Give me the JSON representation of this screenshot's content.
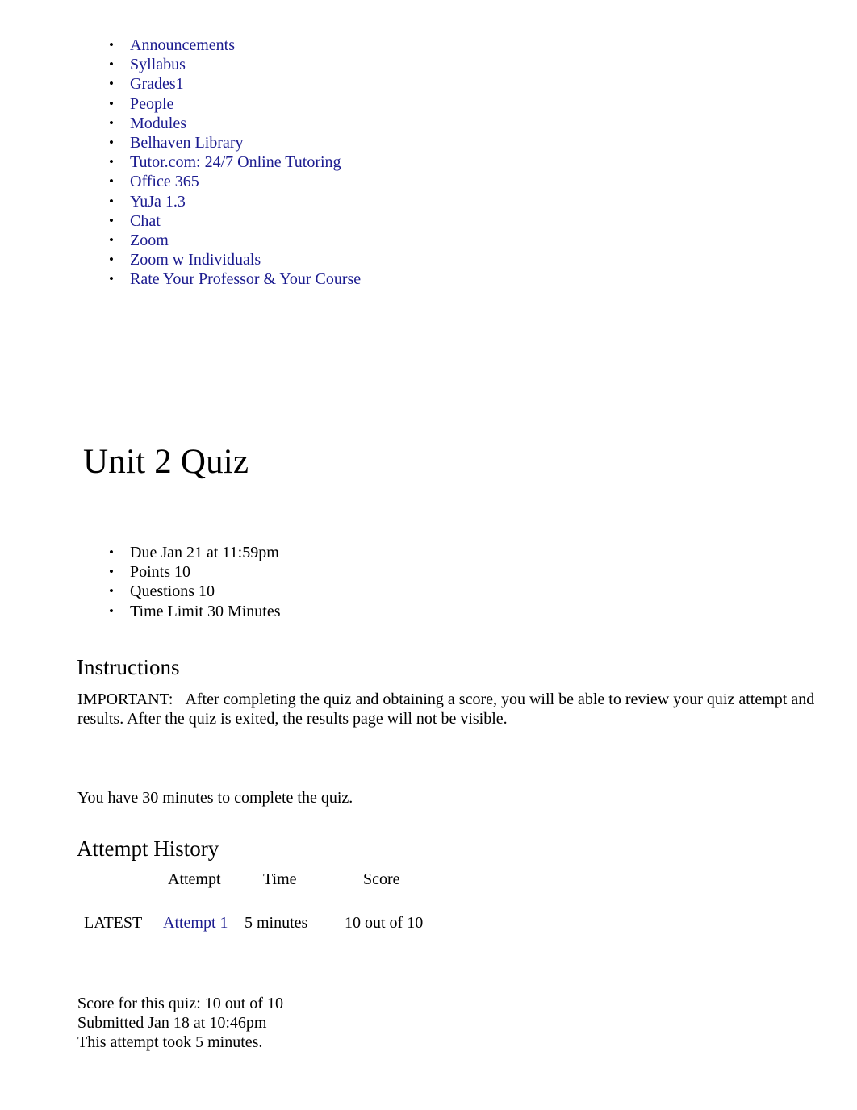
{
  "course_nav": {
    "items": [
      {
        "label": "Announcements"
      },
      {
        "label": "Syllabus"
      },
      {
        "label": "Grades1"
      },
      {
        "label": "People"
      },
      {
        "label": "Modules"
      },
      {
        "label": "Belhaven Library"
      },
      {
        "label": "Tutor.com: 24/7 Online Tutoring"
      },
      {
        "label": "Office 365"
      },
      {
        "label": "YuJa 1.3"
      },
      {
        "label": "Chat"
      },
      {
        "label": "Zoom"
      },
      {
        "label": "Zoom w Individuals"
      },
      {
        "label": "Rate Your Professor & Your Course"
      }
    ]
  },
  "quiz": {
    "title": "Unit 2 Quiz",
    "details": [
      {
        "label": "Due Jan 21 at 11:59pm"
      },
      {
        "label": "Points 10"
      },
      {
        "label": "Questions 10"
      },
      {
        "label": "Time Limit 30 Minutes"
      }
    ]
  },
  "instructions": {
    "heading": "Instructions",
    "label": "IMPORTANT:",
    "body": "After completing the quiz and obtaining a score, you will be able to review your quiz attempt and results. After the quiz is exited, the results page will not be visible.",
    "time_note": "You have  30 minutes to complete the quiz."
  },
  "attempt_history": {
    "heading": "Attempt History",
    "columns": {
      "latest": "",
      "attempt": "Attempt",
      "time": "Time",
      "score": "Score"
    },
    "rows": [
      {
        "latest": "LATEST",
        "attempt": "Attempt 1",
        "time": "5 minutes",
        "score": "10 out of 10"
      }
    ]
  },
  "result_summary": {
    "score": "Score for this quiz: 10 out of 10",
    "submitted": "Submitted Jan 18 at 10:46pm",
    "duration": "This attempt took 5 minutes."
  },
  "colors": {
    "link": "#1b1b8f",
    "text": "#000000",
    "background": "#ffffff"
  }
}
